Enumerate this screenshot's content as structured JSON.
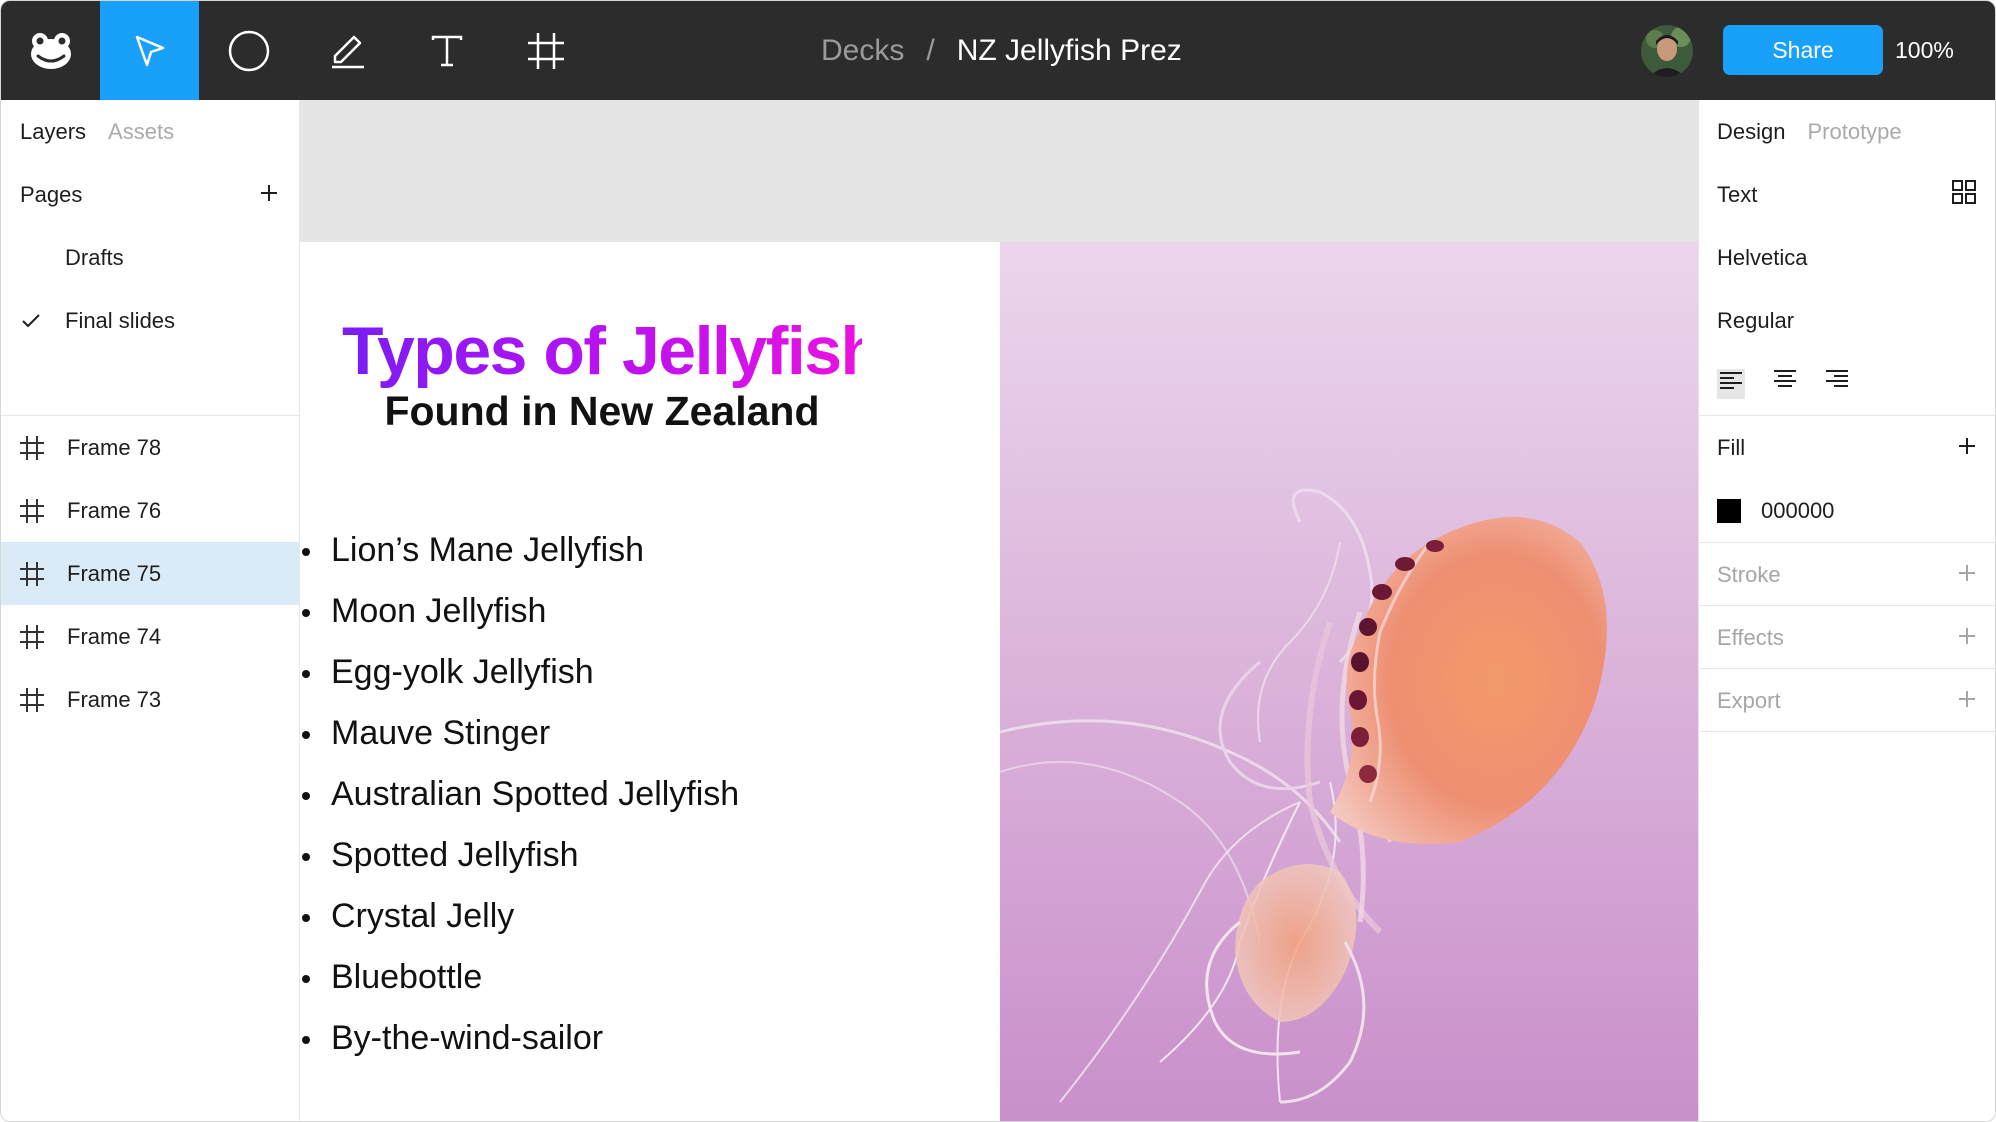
{
  "toolbar": {
    "breadcrumb_parent": "Decks",
    "breadcrumb_separator": "/",
    "document_title": "NZ Jellyfish Prez",
    "share_label": "Share",
    "zoom": "100%",
    "tools": [
      "menu-logo",
      "move-tool",
      "ellipse-tool",
      "pen-tool",
      "text-tool",
      "frame-tool"
    ],
    "active_tool": "move-tool",
    "accent_color": "#18a0fb"
  },
  "left_panel": {
    "tabs": [
      "Layers",
      "Assets"
    ],
    "active_tab": "Layers",
    "pages_label": "Pages",
    "pages": [
      {
        "label": "Drafts",
        "checked": false
      },
      {
        "label": "Final slides",
        "checked": true
      }
    ],
    "frames": [
      {
        "label": "Frame 78",
        "selected": false
      },
      {
        "label": "Frame 76",
        "selected": false
      },
      {
        "label": "Frame 75",
        "selected": true
      },
      {
        "label": "Frame 74",
        "selected": false
      },
      {
        "label": "Frame 73",
        "selected": false
      }
    ]
  },
  "slide": {
    "title": "Types of Jellyfish",
    "subtitle": "Found in New Zealand",
    "bullets": [
      "Lion’s Mane Jellyfish",
      "Moon Jellyfish",
      "Egg-yolk Jellyfish",
      "Mauve Stinger",
      "Australian Spotted Jellyfish",
      "Spotted Jellyfish",
      "Crystal Jelly",
      "Bluebottle",
      "By-the-wind-sailor"
    ]
  },
  "right_panel": {
    "tabs": [
      "Design",
      "Prototype"
    ],
    "active_tab": "Design",
    "text_section": "Text",
    "font_family": "Helvetica",
    "font_weight": "Regular",
    "alignment": "left",
    "fill_section": "Fill",
    "fill_color": "000000",
    "stroke_section": "Stroke",
    "effects_section": "Effects",
    "export_section": "Export"
  }
}
